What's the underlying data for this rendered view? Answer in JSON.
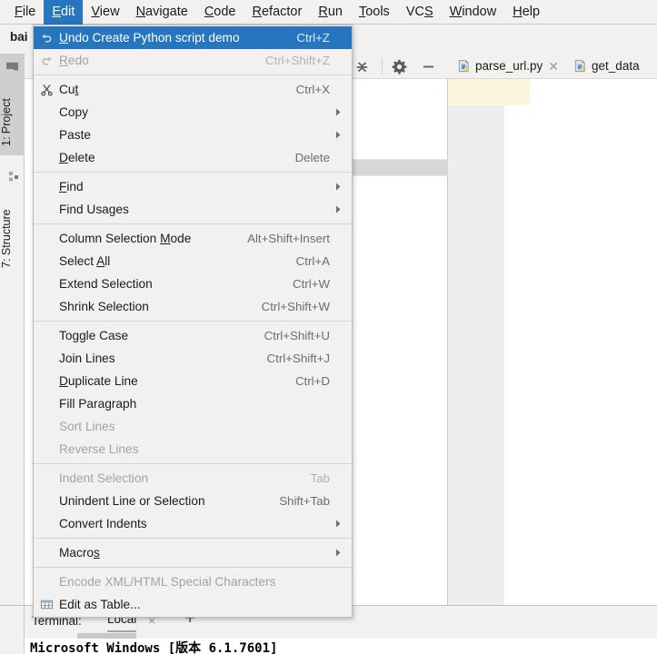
{
  "menubar": {
    "items": [
      {
        "label": "File",
        "mnemonic": "F",
        "active": false
      },
      {
        "label": "Edit",
        "mnemonic": "E",
        "active": true
      },
      {
        "label": "View",
        "mnemonic": "V",
        "active": false
      },
      {
        "label": "Navigate",
        "mnemonic": "N",
        "active": false
      },
      {
        "label": "Code",
        "mnemonic": "C",
        "active": false
      },
      {
        "label": "Refactor",
        "mnemonic": "R",
        "active": false
      },
      {
        "label": "Run",
        "mnemonic": "R",
        "active": false
      },
      {
        "label": "Tools",
        "mnemonic": "T",
        "active": false
      },
      {
        "label": "VCS",
        "mnemonic": "S",
        "active": false
      },
      {
        "label": "Window",
        "mnemonic": "W",
        "active": false
      },
      {
        "label": "Help",
        "mnemonic": "H",
        "active": false
      }
    ]
  },
  "navstrip": {
    "breadcrumb": "bai"
  },
  "left_stripe": {
    "tabs": [
      {
        "label": "1: Project",
        "mnemonic": "1",
        "icon": "folder-icon",
        "selected": true
      },
      {
        "label": "7: Structure",
        "mnemonic": "7",
        "icon": "structure-icon",
        "selected": false
      }
    ]
  },
  "project_toolbar": {
    "buttons": [
      {
        "icon": "collapse-all-icon",
        "name": "collapse-all-button"
      },
      {
        "icon": "gear-icon",
        "name": "settings-button"
      },
      {
        "icon": "minimize-icon",
        "name": "hide-button"
      }
    ]
  },
  "editor_tabs": [
    {
      "label": "parse_url.py",
      "icon": "python-file-icon",
      "closable": true,
      "active": false
    },
    {
      "label": "get_data",
      "icon": "python-file-icon",
      "closable": false,
      "active": true
    }
  ],
  "edit_menu": {
    "items": [
      {
        "type": "item",
        "label": "Undo Create Python script demo",
        "mnemonic": "U",
        "shortcut": "Ctrl+Z",
        "icon": "undo-icon",
        "state": "highlight",
        "submenu": false
      },
      {
        "type": "item",
        "label": "Redo",
        "mnemonic": "R",
        "shortcut": "Ctrl+Shift+Z",
        "icon": "redo-icon",
        "state": "disabled",
        "submenu": false
      },
      {
        "type": "separator"
      },
      {
        "type": "item",
        "label": "Cut",
        "mnemonic": "t",
        "shortcut": "Ctrl+X",
        "icon": "scissors-icon",
        "state": "normal",
        "submenu": false
      },
      {
        "type": "item",
        "label": "Copy",
        "mnemonic": "",
        "shortcut": "",
        "icon": "",
        "state": "normal",
        "submenu": true
      },
      {
        "type": "item",
        "label": "Paste",
        "mnemonic": "",
        "shortcut": "",
        "icon": "",
        "state": "normal",
        "submenu": true
      },
      {
        "type": "item",
        "label": "Delete",
        "mnemonic": "D",
        "shortcut": "Delete",
        "icon": "",
        "state": "normal",
        "submenu": false
      },
      {
        "type": "separator"
      },
      {
        "type": "item",
        "label": "Find",
        "mnemonic": "F",
        "shortcut": "",
        "icon": "",
        "state": "normal",
        "submenu": true
      },
      {
        "type": "item",
        "label": "Find Usages",
        "mnemonic": "",
        "shortcut": "",
        "icon": "",
        "state": "normal",
        "submenu": true
      },
      {
        "type": "separator"
      },
      {
        "type": "item",
        "label": "Column Selection Mode",
        "mnemonic": "M",
        "shortcut": "Alt+Shift+Insert",
        "icon": "",
        "state": "normal",
        "submenu": false
      },
      {
        "type": "item",
        "label": "Select All",
        "mnemonic": "A",
        "shortcut": "Ctrl+A",
        "icon": "",
        "state": "normal",
        "submenu": false
      },
      {
        "type": "item",
        "label": "Extend Selection",
        "mnemonic": "",
        "shortcut": "Ctrl+W",
        "icon": "",
        "state": "normal",
        "submenu": false
      },
      {
        "type": "item",
        "label": "Shrink Selection",
        "mnemonic": "",
        "shortcut": "Ctrl+Shift+W",
        "icon": "",
        "state": "normal",
        "submenu": false
      },
      {
        "type": "separator"
      },
      {
        "type": "item",
        "label": "Toggle Case",
        "mnemonic": "",
        "shortcut": "Ctrl+Shift+U",
        "icon": "",
        "state": "normal",
        "submenu": false
      },
      {
        "type": "item",
        "label": "Join Lines",
        "mnemonic": "",
        "shortcut": "Ctrl+Shift+J",
        "icon": "",
        "state": "normal",
        "submenu": false
      },
      {
        "type": "item",
        "label": "Duplicate Line",
        "mnemonic": "D",
        "shortcut": "Ctrl+D",
        "icon": "",
        "state": "normal",
        "submenu": false
      },
      {
        "type": "item",
        "label": "Fill Paragraph",
        "mnemonic": "",
        "shortcut": "",
        "icon": "",
        "state": "normal",
        "submenu": false
      },
      {
        "type": "item",
        "label": "Sort Lines",
        "mnemonic": "",
        "shortcut": "",
        "icon": "",
        "state": "disabled",
        "submenu": false
      },
      {
        "type": "item",
        "label": "Reverse Lines",
        "mnemonic": "",
        "shortcut": "",
        "icon": "",
        "state": "disabled",
        "submenu": false
      },
      {
        "type": "separator"
      },
      {
        "type": "item",
        "label": "Indent Selection",
        "mnemonic": "",
        "shortcut": "Tab",
        "icon": "",
        "state": "disabled",
        "submenu": false
      },
      {
        "type": "item",
        "label": "Unindent Line or Selection",
        "mnemonic": "",
        "shortcut": "Shift+Tab",
        "icon": "",
        "state": "normal",
        "submenu": false
      },
      {
        "type": "item",
        "label": "Convert Indents",
        "mnemonic": "",
        "shortcut": "",
        "icon": "",
        "state": "normal",
        "submenu": true
      },
      {
        "type": "separator"
      },
      {
        "type": "item",
        "label": "Macros",
        "mnemonic": "s",
        "shortcut": "",
        "icon": "",
        "state": "normal",
        "submenu": true
      },
      {
        "type": "separator"
      },
      {
        "type": "item",
        "label": "Encode XML/HTML Special Characters",
        "mnemonic": "",
        "shortcut": "",
        "icon": "",
        "state": "disabled",
        "submenu": false
      },
      {
        "type": "item",
        "label": "Edit as Table...",
        "mnemonic": "",
        "shortcut": "",
        "icon": "table-icon",
        "state": "normal",
        "submenu": false
      }
    ]
  },
  "terminal": {
    "label": "Terminal:",
    "tab": "Local",
    "close": "×",
    "add": "+",
    "output": "Microsoft Windows [版本 6.1.7601]"
  },
  "colors": {
    "accent_blue": "#2675bf",
    "menu_bg": "#f2f1f0",
    "current_line": "#fdf6dd",
    "selected_row": "#d7d7d7"
  }
}
